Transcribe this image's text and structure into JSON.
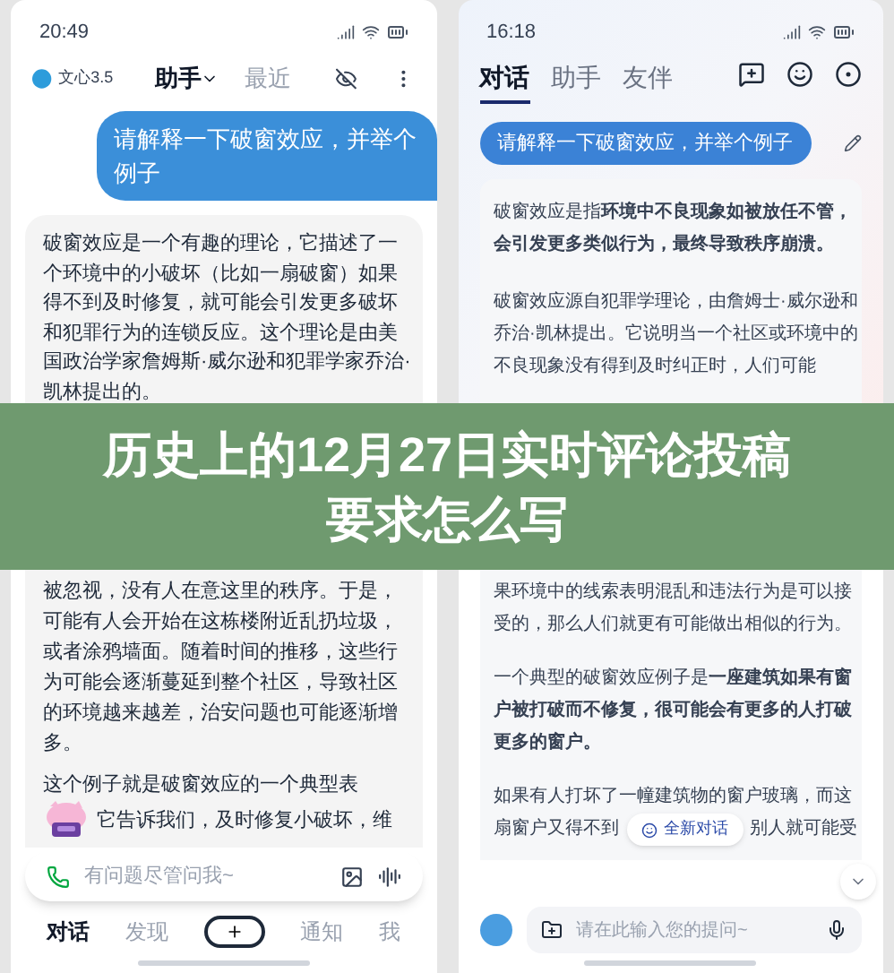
{
  "left_screen": {
    "status_bar": {
      "time": "20:49"
    },
    "header": {
      "model": "文心3.5",
      "tabs": [
        {
          "label": "助手",
          "selected": true
        },
        {
          "label": "最近",
          "selected": false
        }
      ]
    },
    "user_message": "请解释一下破窗效应，并举个例子",
    "answer_top": "破窗效应是一个有趣的理论，它描述了一个环境中的小破坏（比如一扇破窗）如果得不到及时修复，就可能会引发更多破坏和犯罪行为的连锁反应。这个理论是由美国政治学家詹姆斯·威尔逊和犯罪学家乔治·凯林提出的。",
    "answer_bottom": [
      "被忽视，没有人在意这里的秩序。于是，可能有人会开始在这栋楼附近乱扔垃圾，或者涂鸦墙面。随着时间的推移，这些行为可能会逐渐蔓延到整个社区，导致社区的环境越来越差，治安问题也可能逐渐增多。",
      "这个例子就是破窗效应的一个典型表"
    ],
    "answer_tail": "它告诉我们，及时修复小破坏，维",
    "input": {
      "placeholder": "有问题尽管问我~"
    },
    "nav": [
      {
        "kind": "tab",
        "label": "对话",
        "selected": true
      },
      {
        "kind": "tab",
        "label": "发现",
        "selected": false
      },
      {
        "kind": "add"
      },
      {
        "kind": "tab",
        "label": "通知",
        "selected": false
      },
      {
        "kind": "tab",
        "label": "我",
        "selected": false
      }
    ]
  },
  "banner": {
    "title": "历史上的12月27日实时评论投稿要求怎么写"
  },
  "right_screen": {
    "status_bar": {
      "time": "16:18"
    },
    "tabs": [
      {
        "label": "对话",
        "selected": true
      },
      {
        "label": "助手",
        "selected": false
      },
      {
        "label": "友伴",
        "selected": false
      }
    ],
    "user_message": "请解释一下破窗效应，并举个例子",
    "answer_top": [
      "破窗效应是指**环境中不良现象如被放任不管，会引发更多类似行为，最终导致秩序崩溃。**",
      "破窗效应源自犯罪学理论，由詹姆士·威尔逊和乔治·凯林提出。它说明当一个社区或环境中的不良现象没有得到及时纠正时，人们可能"
    ],
    "answer_bottom": [
      "果环境中的线索表明混乱和违法行为是可以接受的，那么人们就更有可能做出相似的行为。",
      "一个典型的破窗效应例子是**一座建筑如果有窗户被打破而不修复，很可能会有更多的人打破更多的窗户。**",
      "如果有人打坏了一幢建筑物的窗户玻璃，而这"
    ],
    "answer_tail": [
      "扇窗户又得不到",
      "别人就可能受"
    ],
    "new_chat_button": "全新对话",
    "input": {
      "placeholder": "请在此输入您的提问~"
    }
  }
}
